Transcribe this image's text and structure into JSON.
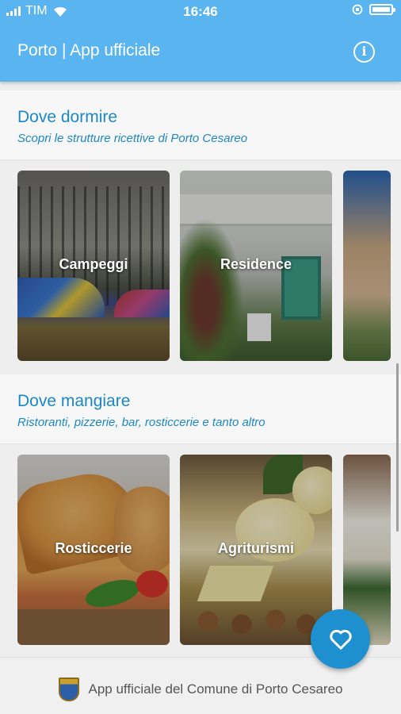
{
  "status_bar": {
    "carrier": "TIM",
    "time": "16:46"
  },
  "app_bar": {
    "title": "Porto | App ufficiale",
    "info_icon": "info-icon"
  },
  "sections": [
    {
      "title": "Dove dormire",
      "subtitle": "Scopri le strutture ricettive di Porto Cesareo",
      "cards": [
        {
          "label": "Campeggi"
        },
        {
          "label": "Residence"
        }
      ]
    },
    {
      "title": "Dove mangiare",
      "subtitle": "Ristoranti, pizzerie, bar, rosticcerie e tanto altro",
      "cards": [
        {
          "label": "Rosticcerie"
        },
        {
          "label": "Agriturismi"
        }
      ]
    }
  ],
  "fab": {
    "icon": "heart-icon"
  },
  "footer": {
    "text": "App ufficiale del Comune di Porto Cesareo",
    "crest_icon": "municipal-crest-icon"
  },
  "colors": {
    "app_bar": "#5ab4ef",
    "accent": "#1d87c6",
    "fab": "#1f90cf"
  }
}
